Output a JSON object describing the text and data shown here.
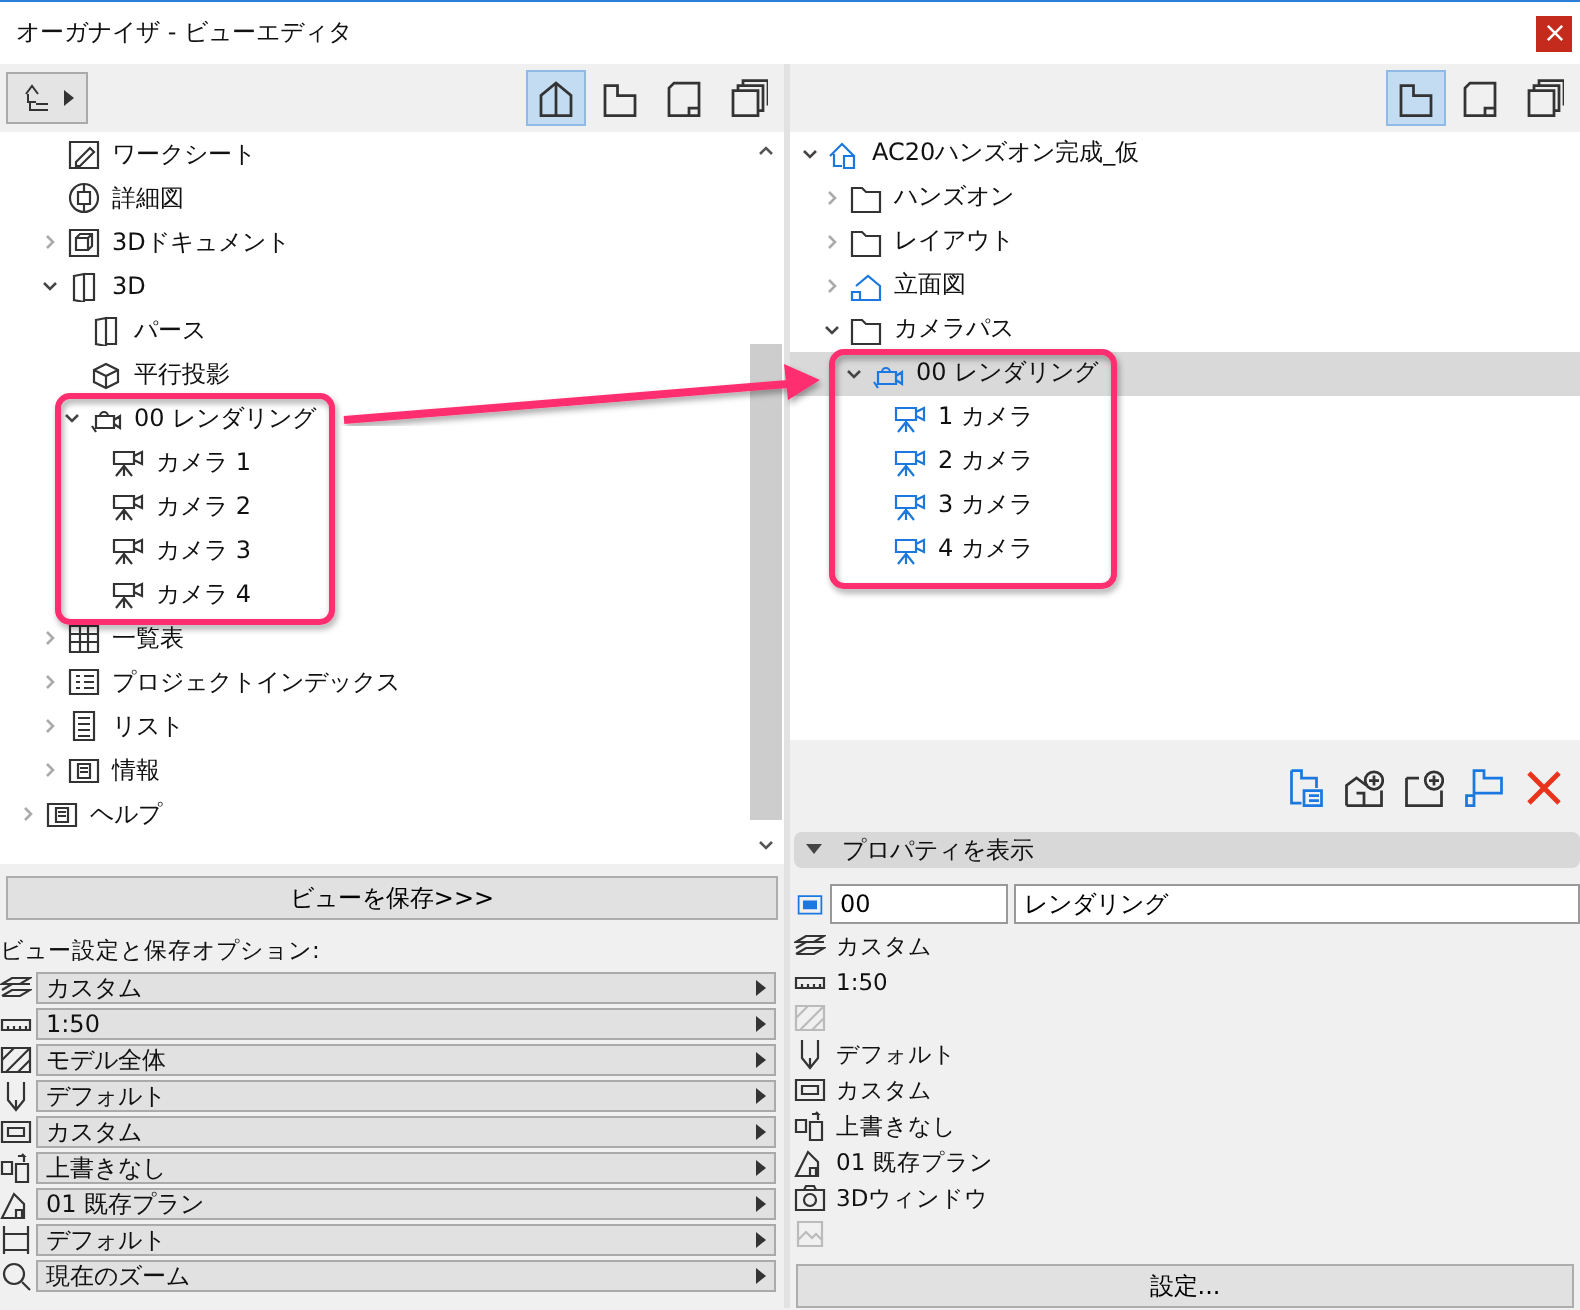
{
  "window": {
    "title": "オーガナイザ - ビューエディタ"
  },
  "left_panel": {
    "toolbar": {
      "tabs": [
        {
          "kind": "house",
          "selected": true
        },
        {
          "kind": "floor",
          "selected": false
        },
        {
          "kind": "sheet",
          "selected": false
        },
        {
          "kind": "stack",
          "selected": false
        }
      ]
    },
    "tree": [
      {
        "label": "ワークシート",
        "kind": "worksheet",
        "selected": false
      },
      {
        "label": "詳細図",
        "kind": "detail",
        "selected": false
      },
      {
        "label": "3Dドキュメント",
        "kind": "document3d",
        "selected": false,
        "expanded": false
      },
      {
        "label": "3D",
        "kind": "view3d",
        "selected": false,
        "expanded": true,
        "children": [
          {
            "label": "パース",
            "kind": "box",
            "selected": false
          },
          {
            "label": "平行投影",
            "kind": "axo",
            "selected": false
          },
          {
            "label": "00 レンダリング",
            "kind": "camera_set",
            "selected": false,
            "expanded": true,
            "children": [
              {
                "label": "カメラ 1",
                "kind": "camera",
                "selected": false
              },
              {
                "label": "カメラ 2",
                "kind": "camera",
                "selected": false
              },
              {
                "label": "カメラ 3",
                "kind": "camera",
                "selected": false
              },
              {
                "label": "カメラ 4",
                "kind": "camera",
                "selected": false
              }
            ]
          }
        ]
      },
      {
        "label": "一覧表",
        "kind": "schedule",
        "selected": false,
        "expanded": false
      },
      {
        "label": "プロジェクトインデックス",
        "kind": "index",
        "selected": false,
        "expanded": false
      },
      {
        "label": "リスト",
        "kind": "list",
        "selected": false,
        "expanded": false
      },
      {
        "label": "情報",
        "kind": "info",
        "selected": false,
        "expanded": false
      },
      {
        "label": "ヘルプ",
        "kind": "info",
        "selected": false,
        "expanded": false,
        "depth0": true
      }
    ],
    "save_button": "ビューを保存>>>",
    "options_label": "ビュー設定と保存オプション:",
    "options": [
      {
        "kind": "layers",
        "value": "カスタム"
      },
      {
        "kind": "ruler",
        "value": "1:50"
      },
      {
        "kind": "hatch",
        "value": "モデル全体"
      },
      {
        "kind": "pen",
        "value": "デフォルト"
      },
      {
        "kind": "frame",
        "value": "カスタム"
      },
      {
        "kind": "override",
        "value": "上書きなし"
      },
      {
        "kind": "plan",
        "value": "01 既存プラン"
      },
      {
        "kind": "dimension",
        "value": "デフォルト"
      },
      {
        "kind": "zoom",
        "value": "現在のズーム"
      }
    ]
  },
  "right_panel": {
    "toolbar": {
      "tabs": [
        {
          "kind": "floor",
          "selected": true
        },
        {
          "kind": "sheet",
          "selected": false
        },
        {
          "kind": "stack",
          "selected": false
        }
      ]
    },
    "tree": [
      {
        "label": "AC20ハンズオン完成_仮",
        "kind": "project",
        "selected": false,
        "expanded": true,
        "children": [
          {
            "label": "ハンズオン",
            "kind": "folder",
            "selected": false,
            "expanded": false
          },
          {
            "label": "レイアウト",
            "kind": "folder",
            "selected": false,
            "expanded": false
          },
          {
            "label": "立面図",
            "kind": "elevation",
            "selected": false,
            "expanded": false
          },
          {
            "label": "カメラパス",
            "kind": "folder",
            "selected": false,
            "expanded": true,
            "children": [
              {
                "label": "00 レンダリング",
                "kind": "camera_set",
                "selected": true,
                "expanded": true,
                "children": [
                  {
                    "label": "1 カメラ",
                    "kind": "camera",
                    "selected": false
                  },
                  {
                    "label": "2 カメラ",
                    "kind": "camera",
                    "selected": false
                  },
                  {
                    "label": "3 カメラ",
                    "kind": "camera",
                    "selected": false
                  },
                  {
                    "label": "4 カメラ",
                    "kind": "camera",
                    "selected": false
                  }
                ]
              }
            ]
          }
        ]
      }
    ],
    "actions": [
      {
        "kind": "sheet_list"
      },
      {
        "kind": "new_view"
      },
      {
        "kind": "new_folder"
      },
      {
        "kind": "folder_move"
      },
      {
        "kind": "delete"
      }
    ],
    "properties_header": "プロパティを表示",
    "id_field": {
      "value": "00"
    },
    "name_field": {
      "value": "レンダリング"
    },
    "properties": [
      {
        "kind": "layers",
        "value": "カスタム",
        "disabled": false
      },
      {
        "kind": "ruler",
        "value": "1:50",
        "disabled": false
      },
      {
        "kind": "hatch",
        "disabled": true
      },
      {
        "kind": "pen",
        "value": "デフォルト",
        "disabled": false
      },
      {
        "kind": "frame",
        "value": "カスタム",
        "disabled": false
      },
      {
        "kind": "override",
        "value": "上書きなし",
        "disabled": false
      },
      {
        "kind": "plan",
        "value": "01 既存プラン",
        "disabled": false
      },
      {
        "kind": "camera3d",
        "value": "3Dウィンドウ",
        "disabled": false
      },
      {
        "kind": "image",
        "disabled": true
      }
    ],
    "settings_button": "設定..."
  }
}
